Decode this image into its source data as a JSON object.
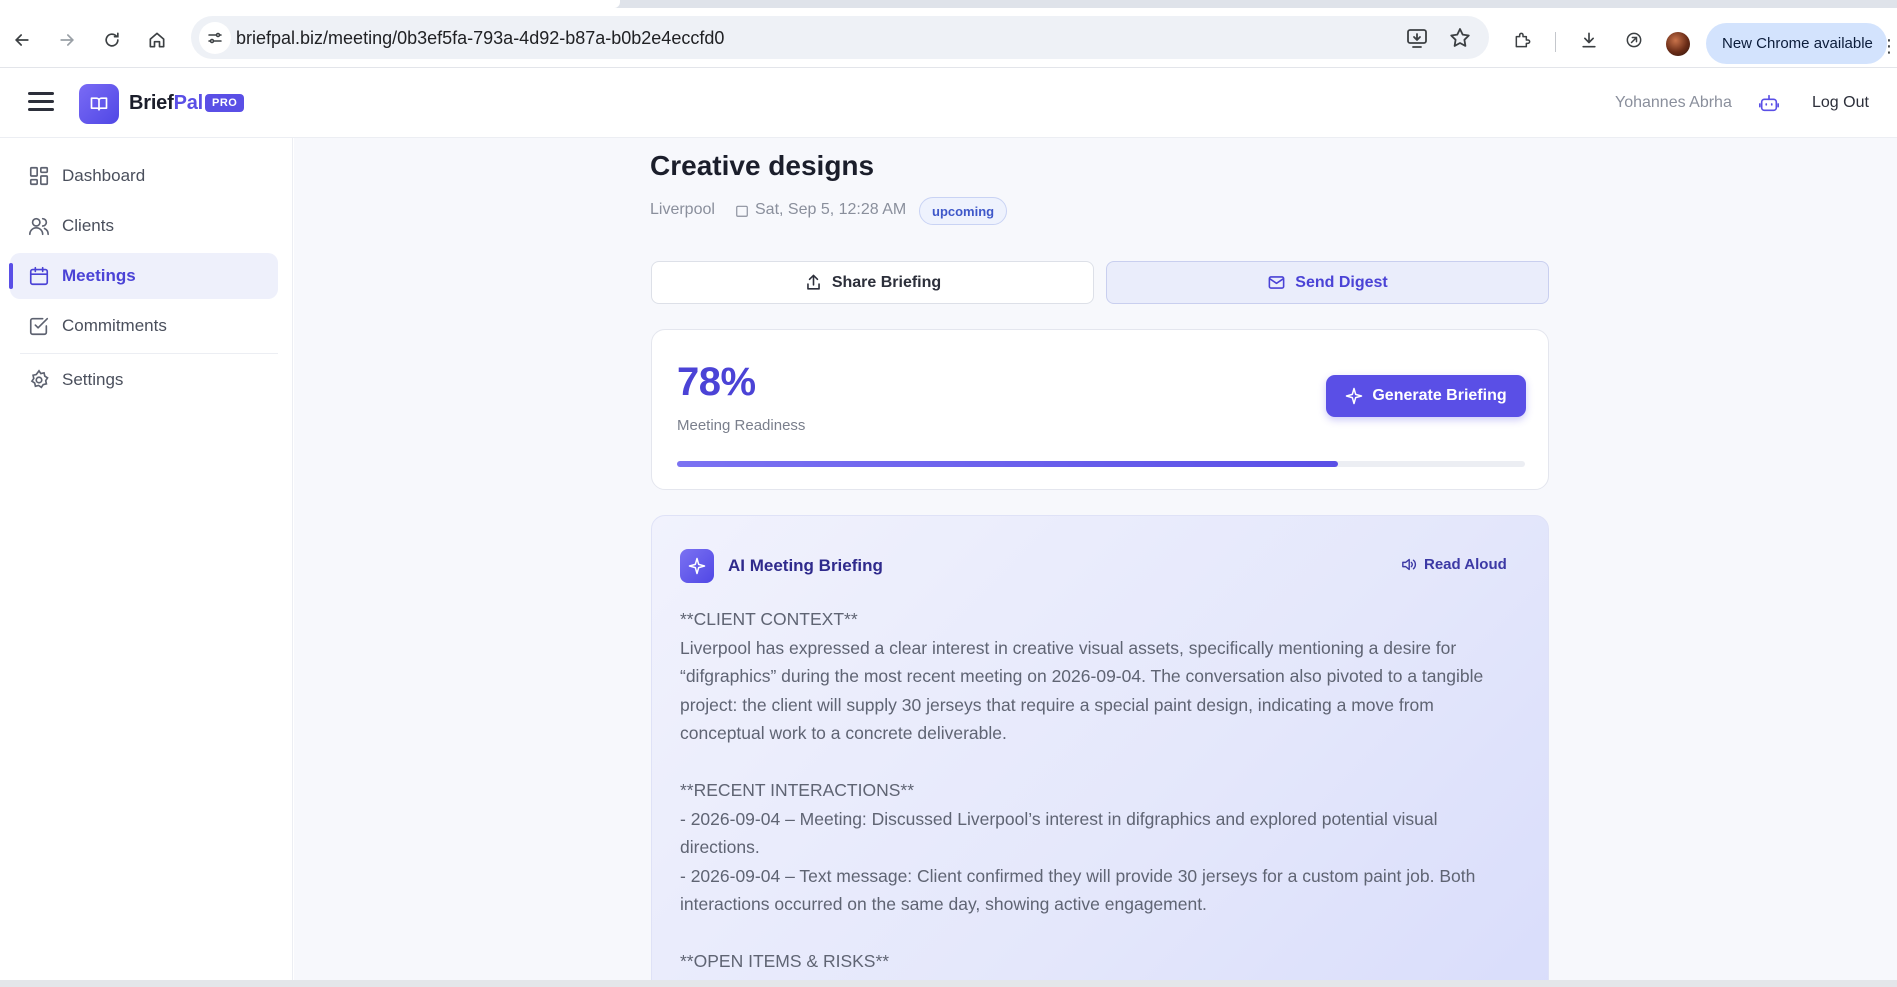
{
  "browser": {
    "url": "briefpal.biz/meeting/0b3ef5fa-793a-4d92-b87a-b0b2e4eccfd0",
    "update_chip": "New Chrome available",
    "icons": [
      "back-icon",
      "forward-icon",
      "reload-icon",
      "home-icon",
      "site-settings-icon",
      "install-app-icon",
      "bookmark-star-icon",
      "extensions-icon",
      "downloads-icon",
      "extension-icon",
      "profile-avatar",
      "more-menu-icon"
    ]
  },
  "header": {
    "brand_part1": "Brief",
    "brand_part2": "Pal",
    "plan_badge": "PRO",
    "user_name": "Yohannes Abrha",
    "logout_label": "Log Out"
  },
  "sidebar": {
    "items": [
      {
        "label": "Dashboard",
        "icon": "dashboard-icon",
        "active": false
      },
      {
        "label": "Clients",
        "icon": "users-icon",
        "active": false
      },
      {
        "label": "Meetings",
        "icon": "calendar-icon",
        "active": true
      },
      {
        "label": "Commitments",
        "icon": "checkbox-icon",
        "active": false
      },
      {
        "label": "Settings",
        "icon": "gear-icon",
        "active": false
      }
    ]
  },
  "meeting": {
    "title": "Creative designs",
    "client": "Liverpool",
    "datetime": "Sat, Sep 5, 12:28 AM",
    "status": "upcoming"
  },
  "actions": {
    "share_label": "Share Briefing",
    "digest_label": "Send Digest"
  },
  "readiness": {
    "value_text": "78%",
    "fraction": 0.78,
    "label": "Meeting Readiness",
    "generate_label": "Generate Briefing"
  },
  "briefing": {
    "title": "AI Meeting Briefing",
    "read_aloud_label": "Read Aloud",
    "body": "**CLIENT CONTEXT**\nLiverpool has expressed a clear interest in creative visual assets, specifically mentioning a desire for “difgraphics” during the most recent meeting on 2026-09-04. The conversation also pivoted to a tangible project: the client will supply 30 jerseys that require a special paint design, indicating a move from conceptual work to a concrete deliverable.\n\n**RECENT INTERACTIONS**\n- 2026-09-04 – Meeting: Discussed Liverpool’s interest in difgraphics and explored potential visual directions.\n- 2026-09-04 – Text message: Client confirmed they will provide 30 jerseys for a custom paint job. Both interactions occurred on the same day, showing active engagement.\n\n**OPEN ITEMS & RISKS**"
  },
  "colors": {
    "accent": "#5a4fe6",
    "accent_dark": "#4b43d6",
    "badge_bg": "#eef2fd",
    "main_bg": "#f7f8fc"
  }
}
